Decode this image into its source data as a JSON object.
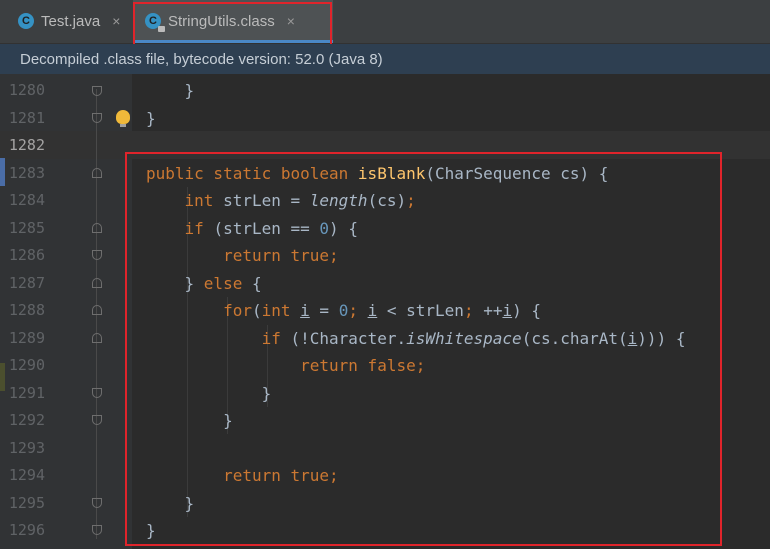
{
  "tabs": [
    {
      "label": "Test.java",
      "icon": "java-class-icon",
      "close": "×"
    },
    {
      "label": "StringUtils.class",
      "icon": "class-file-icon",
      "close": "×"
    }
  ],
  "banner": {
    "text": "Decompiled .class file, bytecode version: 52.0 (Java 8)"
  },
  "editor": {
    "line_numbers": [
      "1280",
      "1281",
      "1282",
      "1283",
      "1284",
      "1285",
      "1286",
      "1287",
      "1288",
      "1289",
      "1290",
      "1291",
      "1292",
      "1293",
      "1294",
      "1295",
      "1296"
    ],
    "current_line": "1282",
    "code": {
      "l1280": "}",
      "l1281": "}",
      "l1283_kw": "public static boolean ",
      "l1283_fn": "isBlank",
      "l1283_rest": "(CharSequence cs) {",
      "l1284_kw": "int ",
      "l1284_a": "strLen = ",
      "l1284_call": "length",
      "l1284_b": "(cs)",
      "l1284_semi": ";",
      "l1285_kw": "if ",
      "l1285_a": "(strLen == ",
      "l1285_num": "0",
      "l1285_b": ") {",
      "l1286_kw": "return true",
      "l1286_semi": ";",
      "l1287_a": "} ",
      "l1287_kw": "else ",
      "l1287_b": "{",
      "l1288_kw": "for",
      "l1288_a": "(",
      "l1288_kw2": "int ",
      "l1288_i1": "i",
      "l1288_b": " = ",
      "l1288_num": "0",
      "l1288_semi1": "; ",
      "l1288_i2": "i",
      "l1288_c": " < strLen",
      "l1288_semi2": "; ",
      "l1288_d": "++",
      "l1288_i3": "i",
      "l1288_e": ") {",
      "l1289_kw": "if ",
      "l1289_a": "(!Character.",
      "l1289_call": "isWhitespace",
      "l1289_b": "(cs.charAt(",
      "l1289_i": "i",
      "l1289_c": "))) {",
      "l1290_kw": "return false",
      "l1290_semi": ";",
      "l1291": "}",
      "l1292": "}",
      "l1294_kw": "return true",
      "l1294_semi": ";",
      "l1295": "}",
      "l1296": "}"
    }
  },
  "colors": {
    "keyword": "#cc7832",
    "function": "#ffc66d",
    "number": "#6897bb",
    "text": "#a9b7c6",
    "highlight": "#e0242b"
  }
}
